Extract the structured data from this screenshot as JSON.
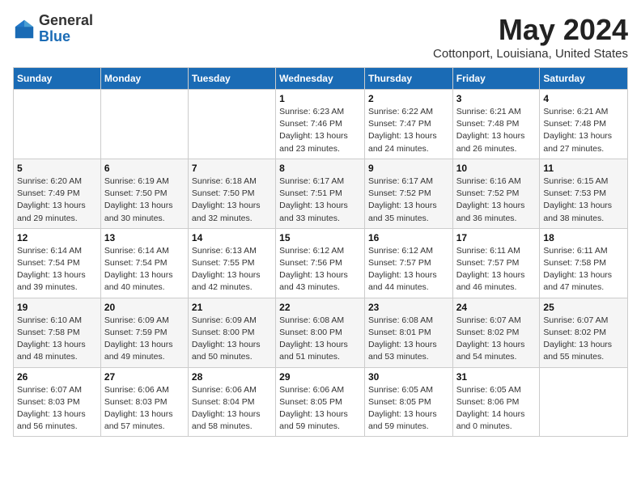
{
  "header": {
    "logo_general": "General",
    "logo_blue": "Blue",
    "month_title": "May 2024",
    "location": "Cottonport, Louisiana, United States"
  },
  "days_of_week": [
    "Sunday",
    "Monday",
    "Tuesday",
    "Wednesday",
    "Thursday",
    "Friday",
    "Saturday"
  ],
  "weeks": [
    [
      {
        "day": "",
        "info": ""
      },
      {
        "day": "",
        "info": ""
      },
      {
        "day": "",
        "info": ""
      },
      {
        "day": "1",
        "info": "Sunrise: 6:23 AM\nSunset: 7:46 PM\nDaylight: 13 hours\nand 23 minutes."
      },
      {
        "day": "2",
        "info": "Sunrise: 6:22 AM\nSunset: 7:47 PM\nDaylight: 13 hours\nand 24 minutes."
      },
      {
        "day": "3",
        "info": "Sunrise: 6:21 AM\nSunset: 7:48 PM\nDaylight: 13 hours\nand 26 minutes."
      },
      {
        "day": "4",
        "info": "Sunrise: 6:21 AM\nSunset: 7:48 PM\nDaylight: 13 hours\nand 27 minutes."
      }
    ],
    [
      {
        "day": "5",
        "info": "Sunrise: 6:20 AM\nSunset: 7:49 PM\nDaylight: 13 hours\nand 29 minutes."
      },
      {
        "day": "6",
        "info": "Sunrise: 6:19 AM\nSunset: 7:50 PM\nDaylight: 13 hours\nand 30 minutes."
      },
      {
        "day": "7",
        "info": "Sunrise: 6:18 AM\nSunset: 7:50 PM\nDaylight: 13 hours\nand 32 minutes."
      },
      {
        "day": "8",
        "info": "Sunrise: 6:17 AM\nSunset: 7:51 PM\nDaylight: 13 hours\nand 33 minutes."
      },
      {
        "day": "9",
        "info": "Sunrise: 6:17 AM\nSunset: 7:52 PM\nDaylight: 13 hours\nand 35 minutes."
      },
      {
        "day": "10",
        "info": "Sunrise: 6:16 AM\nSunset: 7:52 PM\nDaylight: 13 hours\nand 36 minutes."
      },
      {
        "day": "11",
        "info": "Sunrise: 6:15 AM\nSunset: 7:53 PM\nDaylight: 13 hours\nand 38 minutes."
      }
    ],
    [
      {
        "day": "12",
        "info": "Sunrise: 6:14 AM\nSunset: 7:54 PM\nDaylight: 13 hours\nand 39 minutes."
      },
      {
        "day": "13",
        "info": "Sunrise: 6:14 AM\nSunset: 7:54 PM\nDaylight: 13 hours\nand 40 minutes."
      },
      {
        "day": "14",
        "info": "Sunrise: 6:13 AM\nSunset: 7:55 PM\nDaylight: 13 hours\nand 42 minutes."
      },
      {
        "day": "15",
        "info": "Sunrise: 6:12 AM\nSunset: 7:56 PM\nDaylight: 13 hours\nand 43 minutes."
      },
      {
        "day": "16",
        "info": "Sunrise: 6:12 AM\nSunset: 7:57 PM\nDaylight: 13 hours\nand 44 minutes."
      },
      {
        "day": "17",
        "info": "Sunrise: 6:11 AM\nSunset: 7:57 PM\nDaylight: 13 hours\nand 46 minutes."
      },
      {
        "day": "18",
        "info": "Sunrise: 6:11 AM\nSunset: 7:58 PM\nDaylight: 13 hours\nand 47 minutes."
      }
    ],
    [
      {
        "day": "19",
        "info": "Sunrise: 6:10 AM\nSunset: 7:58 PM\nDaylight: 13 hours\nand 48 minutes."
      },
      {
        "day": "20",
        "info": "Sunrise: 6:09 AM\nSunset: 7:59 PM\nDaylight: 13 hours\nand 49 minutes."
      },
      {
        "day": "21",
        "info": "Sunrise: 6:09 AM\nSunset: 8:00 PM\nDaylight: 13 hours\nand 50 minutes."
      },
      {
        "day": "22",
        "info": "Sunrise: 6:08 AM\nSunset: 8:00 PM\nDaylight: 13 hours\nand 51 minutes."
      },
      {
        "day": "23",
        "info": "Sunrise: 6:08 AM\nSunset: 8:01 PM\nDaylight: 13 hours\nand 53 minutes."
      },
      {
        "day": "24",
        "info": "Sunrise: 6:07 AM\nSunset: 8:02 PM\nDaylight: 13 hours\nand 54 minutes."
      },
      {
        "day": "25",
        "info": "Sunrise: 6:07 AM\nSunset: 8:02 PM\nDaylight: 13 hours\nand 55 minutes."
      }
    ],
    [
      {
        "day": "26",
        "info": "Sunrise: 6:07 AM\nSunset: 8:03 PM\nDaylight: 13 hours\nand 56 minutes."
      },
      {
        "day": "27",
        "info": "Sunrise: 6:06 AM\nSunset: 8:03 PM\nDaylight: 13 hours\nand 57 minutes."
      },
      {
        "day": "28",
        "info": "Sunrise: 6:06 AM\nSunset: 8:04 PM\nDaylight: 13 hours\nand 58 minutes."
      },
      {
        "day": "29",
        "info": "Sunrise: 6:06 AM\nSunset: 8:05 PM\nDaylight: 13 hours\nand 59 minutes."
      },
      {
        "day": "30",
        "info": "Sunrise: 6:05 AM\nSunset: 8:05 PM\nDaylight: 13 hours\nand 59 minutes."
      },
      {
        "day": "31",
        "info": "Sunrise: 6:05 AM\nSunset: 8:06 PM\nDaylight: 14 hours\nand 0 minutes."
      },
      {
        "day": "",
        "info": ""
      }
    ]
  ]
}
